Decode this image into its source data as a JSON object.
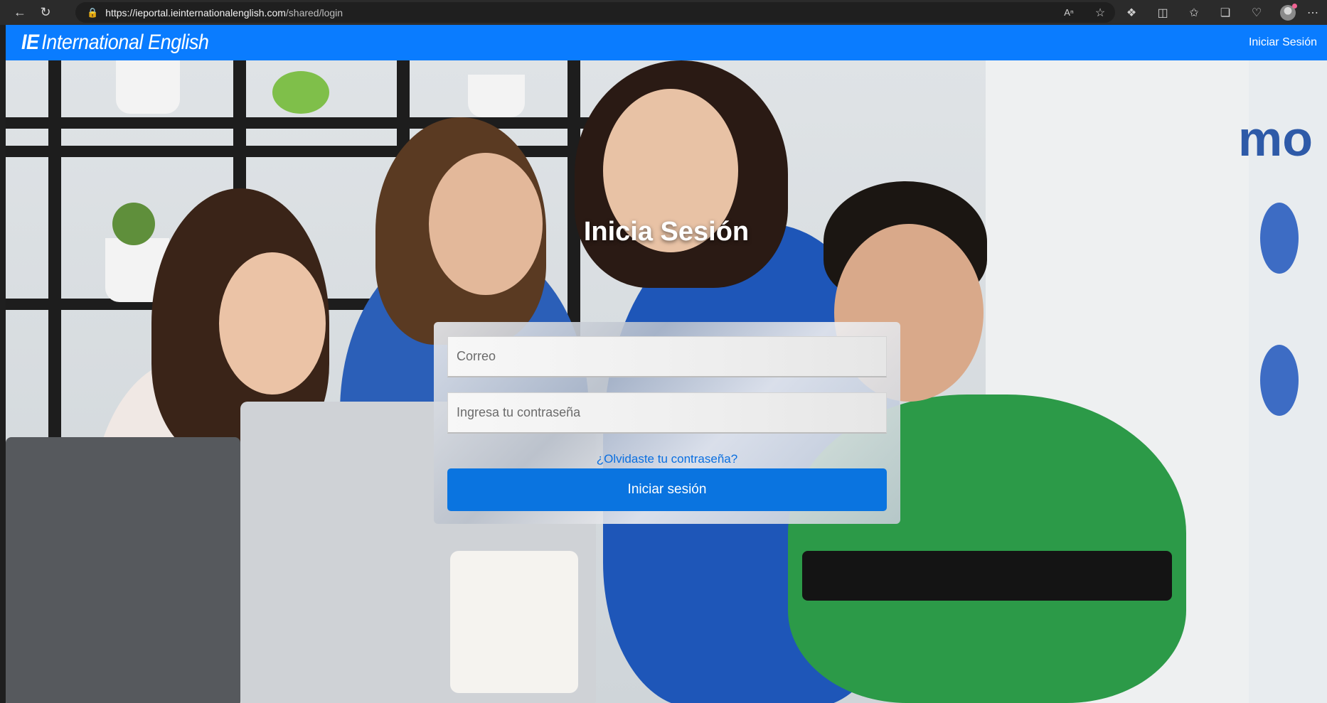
{
  "browser": {
    "url_host": "https://ieportal.ieinternationalenglish.com",
    "url_path": "/shared/login"
  },
  "navbar": {
    "brand_ie": "IE",
    "brand_name": "International English",
    "login_link": "Iniciar Sesión"
  },
  "login": {
    "title": "Inicia Sesión",
    "email_placeholder": "Correo",
    "password_placeholder": "Ingresa tu contraseña",
    "forgot_link": "¿Olvidaste tu contraseña?",
    "submit_label": "Iniciar sesión"
  },
  "colors": {
    "navbar": "#0a7cff",
    "button": "#0a74e0",
    "link": "#0a6fe0"
  },
  "icons": [
    "back-icon",
    "reload-icon",
    "lock-icon",
    "read-aloud-icon",
    "favorite-star-icon",
    "extensions-icon",
    "split-screen-icon",
    "favorites-icon",
    "collections-icon",
    "heart-monitor-icon",
    "profile-avatar-icon",
    "more-icon"
  ]
}
